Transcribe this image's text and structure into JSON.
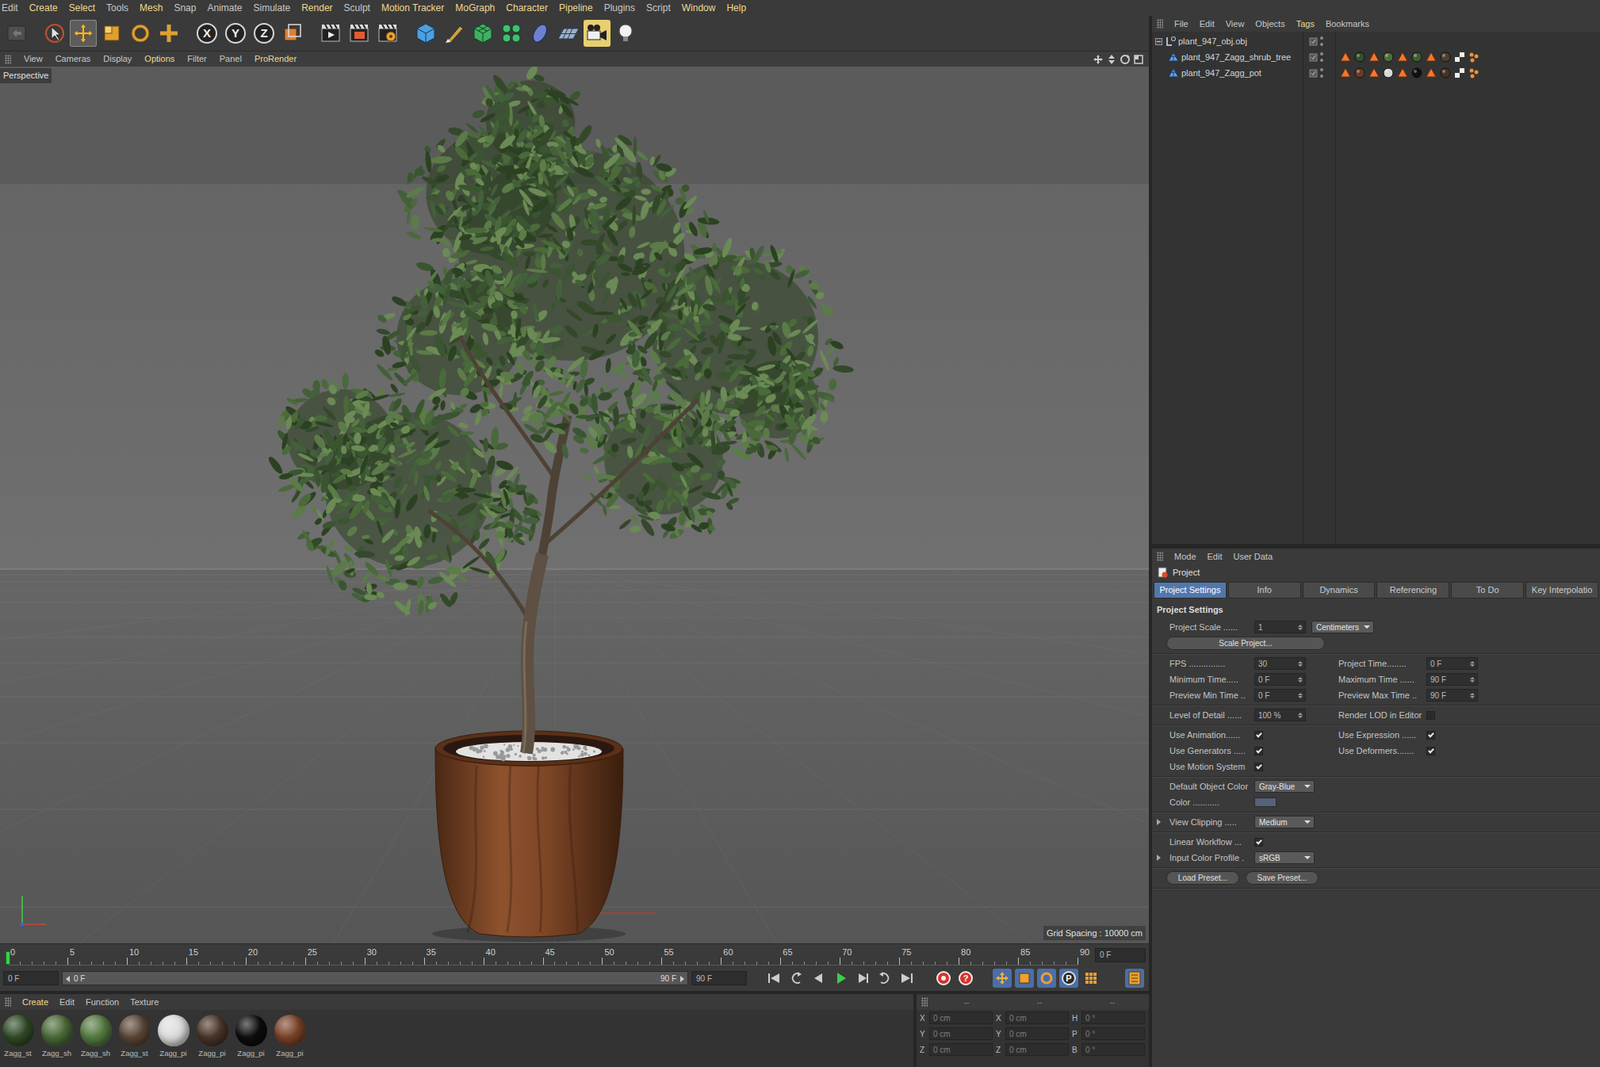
{
  "menubar": [
    {
      "label": "Edit",
      "accent": false
    },
    {
      "label": "Create",
      "accent": true
    },
    {
      "label": "Select",
      "accent": true
    },
    {
      "label": "Tools",
      "accent": false
    },
    {
      "label": "Mesh",
      "accent": true
    },
    {
      "label": "Snap",
      "accent": false
    },
    {
      "label": "Animate",
      "accent": false
    },
    {
      "label": "Simulate",
      "accent": false
    },
    {
      "label": "Render",
      "accent": true
    },
    {
      "label": "Sculpt",
      "accent": false
    },
    {
      "label": "Motion Tracker",
      "accent": true
    },
    {
      "label": "MoGraph",
      "accent": true
    },
    {
      "label": "Character",
      "accent": true
    },
    {
      "label": "Pipeline",
      "accent": true
    },
    {
      "label": "Plugins",
      "accent": false
    },
    {
      "label": "Script",
      "accent": false
    },
    {
      "label": "Window",
      "accent": true
    },
    {
      "label": "Help",
      "accent": true
    }
  ],
  "toolbar": {
    "tools": [
      {
        "selected": false
      },
      {
        "selected": true
      },
      {
        "selected": false
      },
      {
        "selected": false
      },
      {
        "selected": false
      }
    ],
    "axes": [
      {
        "label": "X",
        "on": true
      },
      {
        "label": "Y",
        "on": true
      },
      {
        "label": "Z",
        "on": true
      }
    ]
  },
  "viewport": {
    "menu": [
      {
        "label": "View",
        "accent": false
      },
      {
        "label": "Cameras",
        "accent": false
      },
      {
        "label": "Display",
        "accent": false
      },
      {
        "label": "Options",
        "accent": true
      },
      {
        "label": "Filter",
        "accent": false
      },
      {
        "label": "Panel",
        "accent": false
      },
      {
        "label": "ProRender",
        "accent": true
      }
    ],
    "camera": "Perspective",
    "grid_spacing": "Grid Spacing : 10000 cm"
  },
  "timeline": {
    "ticks": [
      "0",
      "5",
      "10",
      "15",
      "20",
      "25",
      "30",
      "35",
      "40",
      "45",
      "50",
      "55",
      "60",
      "65",
      "70",
      "75",
      "80",
      "85",
      "90"
    ],
    "playhead": {
      "level": 0
    },
    "current": "0 F"
  },
  "transport": {
    "start": "0 F",
    "range_start": "0 F",
    "range_end": "90 F",
    "end": "90 F",
    "autokey": "?",
    "pla": "P"
  },
  "object_manager": {
    "menu": [
      {
        "label": "File",
        "accent": false
      },
      {
        "label": "Edit",
        "accent": false
      },
      {
        "label": "View",
        "accent": false
      },
      {
        "label": "Objects",
        "accent": false
      },
      {
        "label": "Tags",
        "accent": true
      },
      {
        "label": "Bookmarks",
        "accent": false
      }
    ],
    "objects": [
      {
        "name": "plant_947_obj.obj",
        "kind": "null",
        "expanded": true,
        "tags": []
      },
      {
        "name": "plant_947_Zagg_shrub_tree",
        "kind": "mesh",
        "tags": [
          {
            "kind": "selection"
          },
          {
            "kind": "material",
            "color": "#34502a"
          },
          {
            "kind": "selection"
          },
          {
            "kind": "material",
            "color": "#4f6e3c"
          },
          {
            "kind": "selection"
          },
          {
            "kind": "material",
            "color": "#3e5f30"
          },
          {
            "kind": "selection"
          },
          {
            "kind": "material",
            "color": "#504030"
          },
          {
            "kind": "uvw"
          },
          {
            "kind": "phong"
          }
        ]
      },
      {
        "name": "plant_947_Zagg_pot",
        "kind": "mesh",
        "tags": [
          {
            "kind": "selection"
          },
          {
            "kind": "material",
            "color": "#6b3a22"
          },
          {
            "kind": "selection"
          },
          {
            "kind": "material",
            "color": "#d8d8d8"
          },
          {
            "kind": "selection"
          },
          {
            "kind": "material",
            "color": "#101010"
          },
          {
            "kind": "selection"
          },
          {
            "kind": "material",
            "color": "#4a3026"
          },
          {
            "kind": "uvw"
          },
          {
            "kind": "phong"
          }
        ]
      }
    ]
  },
  "attribute_manager": {
    "menu": [
      "Mode",
      "Edit",
      "User Data"
    ],
    "title": "Project",
    "tabs": [
      {
        "label": "Project Settings",
        "selected": true
      },
      {
        "label": "Info",
        "selected": false
      },
      {
        "label": "Dynamics",
        "selected": false
      },
      {
        "label": "Referencing",
        "selected": false
      },
      {
        "label": "To Do",
        "selected": false
      },
      {
        "label": "Key Interpolatio",
        "selected": false
      }
    ],
    "section": "Project Settings",
    "groups": [
      [
        {
          "cells": [
            {
              "kind": "label",
              "text": "Project Scale ......"
            },
            {
              "kind": "number",
              "text": "1"
            },
            {
              "kind": "dropdown",
              "text": "Centimeters"
            }
          ]
        },
        {
          "cells": [
            {
              "kind": "button",
              "text": "Scale Project..."
            }
          ]
        }
      ],
      [
        {
          "cells": [
            {
              "kind": "label",
              "text": "FPS ..............."
            },
            {
              "kind": "number",
              "text": "30"
            },
            {
              "kind": "label",
              "text": "Project Time........"
            },
            {
              "kind": "number",
              "text": "0 F"
            }
          ]
        },
        {
          "cells": [
            {
              "kind": "label",
              "text": "Minimum Time....."
            },
            {
              "kind": "number",
              "text": "0 F"
            },
            {
              "kind": "label",
              "text": "Maximum Time ......"
            },
            {
              "kind": "number",
              "text": "90 F"
            }
          ]
        },
        {
          "cells": [
            {
              "kind": "label",
              "text": "Preview Min Time .."
            },
            {
              "kind": "number",
              "text": "0 F"
            },
            {
              "kind": "label",
              "text": "Preview Max Time .."
            },
            {
              "kind": "number",
              "text": "90 F"
            }
          ]
        }
      ],
      [
        {
          "cells": [
            {
              "kind": "label",
              "text": "Level of Detail ......"
            },
            {
              "kind": "number",
              "text": "100 %"
            },
            {
              "kind": "label",
              "text": "Render LOD in Editor"
            },
            {
              "kind": "check",
              "checked": false
            }
          ]
        }
      ],
      [
        {
          "cells": [
            {
              "kind": "label",
              "text": "Use Animation......"
            },
            {
              "kind": "check",
              "checked": true
            },
            {
              "kind": "label",
              "text": "Use Expression ......"
            },
            {
              "kind": "check",
              "checked": true
            }
          ]
        },
        {
          "cells": [
            {
              "kind": "label",
              "text": "Use Generators ....."
            },
            {
              "kind": "check",
              "checked": true
            },
            {
              "kind": "label",
              "text": "Use Deformers......."
            },
            {
              "kind": "check",
              "checked": true
            }
          ]
        },
        {
          "cells": [
            {
              "kind": "label",
              "text": "Use Motion System"
            },
            {
              "kind": "check",
              "checked": true
            }
          ]
        }
      ],
      [
        {
          "cells": [
            {
              "kind": "label",
              "text": "Default Object Color"
            },
            {
              "kind": "dropdown",
              "text": "Gray-Blue"
            }
          ]
        },
        {
          "cells": [
            {
              "kind": "label",
              "text": "Color ..........."
            },
            {
              "kind": "swatch",
              "color": "#56627a"
            }
          ]
        }
      ],
      [
        {
          "expanded": false,
          "cells": [
            {
              "kind": "label",
              "text": "View Clipping ....."
            },
            {
              "kind": "dropdown",
              "text": "Medium"
            }
          ]
        }
      ],
      [
        {
          "cells": [
            {
              "kind": "label",
              "text": "Linear Workflow ..."
            },
            {
              "kind": "check",
              "checked": true
            }
          ]
        },
        {
          "expanded": false,
          "cells": [
            {
              "kind": "label",
              "text": "Input Color Profile ."
            },
            {
              "kind": "dropdown",
              "text": "sRGB"
            }
          ]
        }
      ],
      [
        {
          "cells": [
            {
              "kind": "button",
              "text": "Load Preset..."
            },
            {
              "kind": "button",
              "text": "Save Preset..."
            }
          ]
        }
      ]
    ]
  },
  "material_manager": {
    "menu": [
      {
        "label": "Create",
        "accent": true
      },
      {
        "label": "Edit",
        "accent": false
      },
      {
        "label": "Function",
        "accent": false
      },
      {
        "label": "Texture",
        "accent": false
      }
    ],
    "materials": [
      {
        "name": "Zagg_st",
        "color": "#2f4a25"
      },
      {
        "name": "Zagg_sh",
        "color": "#4a6a38"
      },
      {
        "name": "Zagg_sh",
        "color": "#557a40"
      },
      {
        "name": "Zagg_st",
        "color": "#5a4636"
      },
      {
        "name": "Zagg_pi",
        "color": "#dcdcdc"
      },
      {
        "name": "Zagg_pi",
        "color": "#4a3428"
      },
      {
        "name": "Zagg_pi",
        "color": "#0d0d0d"
      },
      {
        "name": "Zagg_pi",
        "color": "#7a4228"
      }
    ]
  },
  "coordinates": {
    "headers": [
      "--",
      "--",
      "--"
    ],
    "rows": [
      [
        {
          "axis": "X",
          "value": "0 cm"
        },
        {
          "axis": "X",
          "value": "0 cm"
        },
        {
          "axis": "H",
          "value": "0 °"
        }
      ],
      [
        {
          "axis": "Y",
          "value": "0 cm"
        },
        {
          "axis": "Y",
          "value": "0 cm"
        },
        {
          "axis": "P",
          "value": "0 °"
        }
      ],
      [
        {
          "axis": "Z",
          "value": "0 cm"
        },
        {
          "axis": "Z",
          "value": "0 cm"
        },
        {
          "axis": "B",
          "value": "0 °"
        }
      ]
    ]
  }
}
